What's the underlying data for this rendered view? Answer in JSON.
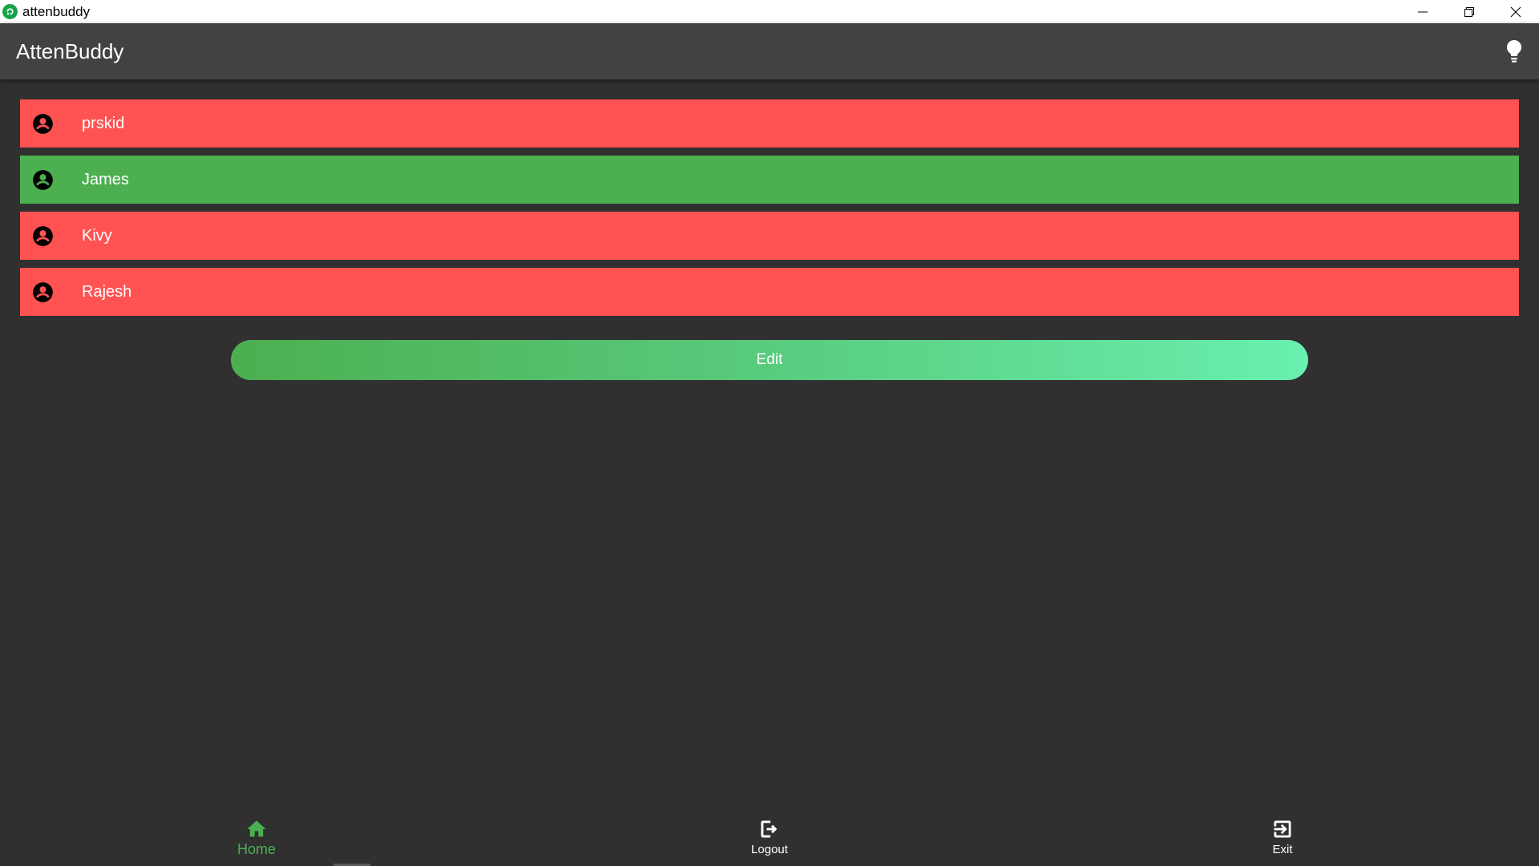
{
  "window": {
    "title": "attenbuddy",
    "controls": [
      "minimize-icon",
      "restore-icon",
      "close-icon"
    ]
  },
  "appbar": {
    "title": "AttenBuddy",
    "action_icon": "lightbulb-icon"
  },
  "students": [
    {
      "name": "prskid",
      "status": "absent",
      "color": "#ff5252"
    },
    {
      "name": "James",
      "status": "present",
      "color": "#4caf50"
    },
    {
      "name": "Kivy",
      "status": "absent",
      "color": "#ff5252"
    },
    {
      "name": "Rajesh",
      "status": "absent",
      "color": "#ff5252"
    }
  ],
  "edit_button": {
    "label": "Edit",
    "gradient": [
      "#4caf50",
      "#69f0ae"
    ]
  },
  "bottom_nav": {
    "items": [
      {
        "label": "Home",
        "icon": "home-icon",
        "active": true
      },
      {
        "label": "Logout",
        "icon": "logout-icon",
        "active": false
      },
      {
        "label": "Exit",
        "icon": "exit-icon",
        "active": false
      }
    ]
  },
  "colors": {
    "background": "#303030",
    "appbar": "#424242",
    "absent": "#ff5252",
    "present": "#4caf50",
    "accent": "#4caf50"
  }
}
